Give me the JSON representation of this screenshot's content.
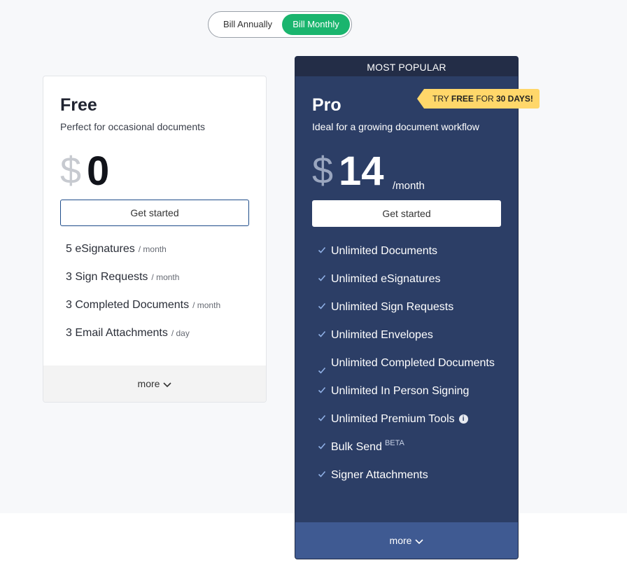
{
  "toggle": {
    "annual_label": "Bill Annually",
    "monthly_label": "Bill Monthly",
    "selected": "monthly"
  },
  "free_plan": {
    "name": "Free",
    "description": "Perfect for occasional documents",
    "currency": "$",
    "price": "0",
    "cta_label": "Get started",
    "features": [
      {
        "text": "5 eSignatures",
        "unit": "/ month"
      },
      {
        "text": "3 Sign Requests",
        "unit": "/ month"
      },
      {
        "text": "3 Completed Documents",
        "unit": "/ month"
      },
      {
        "text": "3 Email Attachments",
        "unit": "/ day"
      }
    ],
    "more_label": "more"
  },
  "pro_plan": {
    "banner": "MOST POPULAR",
    "trial_badge": {
      "prefix": "TRY",
      "bold1": "FREE",
      "middle": "FOR",
      "bold2": "30 DAYS!"
    },
    "name": "Pro",
    "description": "Ideal for a growing document workflow",
    "currency": "$",
    "price": "14",
    "period": "/month",
    "cta_label": "Get started",
    "features": [
      {
        "text": "Unlimited Documents"
      },
      {
        "text": "Unlimited eSignatures"
      },
      {
        "text": "Unlimited Sign Requests"
      },
      {
        "text": "Unlimited Envelopes"
      },
      {
        "text": "Unlimited Completed Documents"
      },
      {
        "text": "Unlimited In Person Signing"
      },
      {
        "text": "Unlimited Premium Tools",
        "icon": "info-icon"
      },
      {
        "text": "Bulk Send",
        "tag": "BETA"
      },
      {
        "text": "Signer Attachments"
      }
    ],
    "more_label": "more"
  },
  "colors": {
    "accent_green": "#1ab56e",
    "pro_bg": "#2c3e66",
    "badge_yellow": "#ffd76a"
  }
}
